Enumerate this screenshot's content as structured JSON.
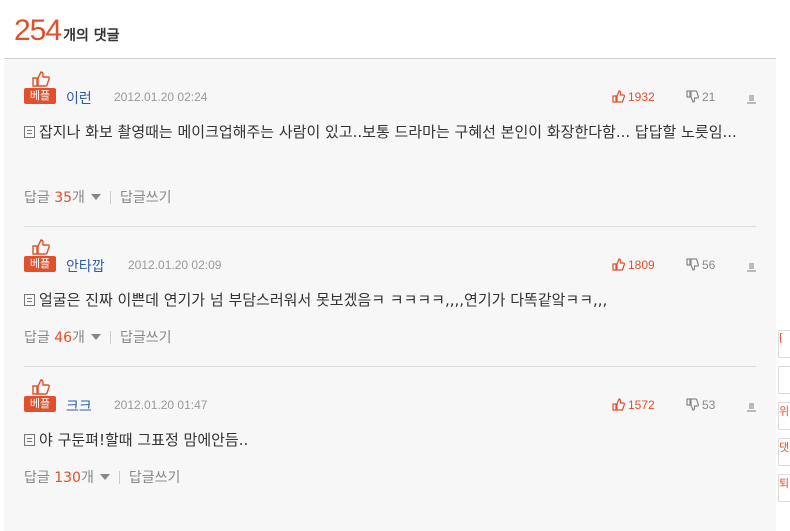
{
  "header": {
    "count": "254",
    "label": "개의 댓글"
  },
  "comments": [
    {
      "badge": "베플",
      "nick": "이런",
      "date": "2012.01.20 02:24",
      "up": "1932",
      "down": "21",
      "text": "잡지나 화보 촬영때는 메이크업해주는 사람이 있고..보통 드라마는 구혜선 본인이 화장한다함... 답답할 노릇임...",
      "reply_label": "답글",
      "reply_count": "35",
      "reply_unit": "개",
      "write_label": "답글쓰기"
    },
    {
      "badge": "베플",
      "nick": "안타깝",
      "date": "2012.01.20 02:09",
      "up": "1809",
      "down": "56",
      "text": "얼굴은 진짜 이쁜데 연기가 넘 부담스러워서 못보겠음ㅋ ㅋㅋㅋㅋ,,,,연기가 다똑같앜ㅋㅋ,,,",
      "reply_label": "답글",
      "reply_count": "46",
      "reply_unit": "개",
      "write_label": "답글쓰기"
    },
    {
      "badge": "베플",
      "nick": "크크",
      "date": "2012.01.20 01:47",
      "up": "1572",
      "down": "53",
      "text": "야 구둔펴!할때 그표정 맘에안듬..",
      "reply_label": "답글",
      "reply_count": "130",
      "reply_unit": "개",
      "write_label": "답글쓰기"
    }
  ],
  "side_tabs": [
    "[",
    "",
    "위",
    "댓",
    "퇴"
  ],
  "colors": {
    "accent": "#e0502c",
    "nick": "#2d5da8",
    "panel_bg": "#f7f7f7"
  },
  "icons": {
    "best": "thumbs-up-icon",
    "up": "thumbs-up-icon",
    "down": "thumbs-down-icon",
    "report": "report-icon",
    "text": "document-icon",
    "replies": "caret-down-icon"
  }
}
